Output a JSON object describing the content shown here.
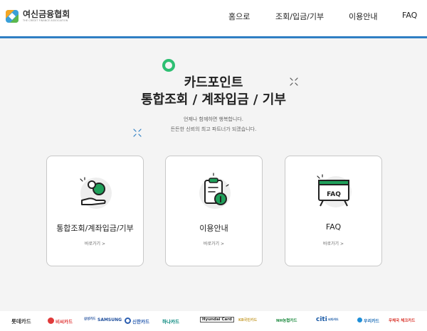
{
  "header": {
    "logo_name": "여신금융협회",
    "logo_sub": "THE CREDIT FINANCE ASSOCIATION",
    "nav": [
      "홈으로",
      "조회/입금/기부",
      "이용안내",
      "FAQ"
    ]
  },
  "hero": {
    "title_line1": "카드포인트",
    "title_line2": "통합조회 / 계좌입금 / 기부",
    "sub_line1": "언제나 함께하면 행복합니다.",
    "sub_line2": "든든한 신뢰의 최고 파트너가 되겠습니다."
  },
  "cards": [
    {
      "title": "통합조회/계좌입금/기부",
      "link": "바로가기 >",
      "icon": "coin-hand-icon"
    },
    {
      "title": "이용안내",
      "link": "바로가기 >",
      "icon": "clipboard-info-icon"
    },
    {
      "title": "FAQ",
      "link": "바로가기 >",
      "icon": "faq-board-icon"
    }
  ],
  "partners": [
    "롯데카드",
    "비씨카드",
    "삼성카드",
    "SAMSUNG",
    "신한카드",
    "하나카드",
    "Hyundai Card",
    "KB국민카드",
    "NH농협카드",
    "citi",
    "씨티카드",
    "우리카드",
    "우체국 체크카드"
  ],
  "colors": {
    "accent": "#2f7fc3",
    "green": "#1fa05a",
    "dark": "#222222"
  }
}
